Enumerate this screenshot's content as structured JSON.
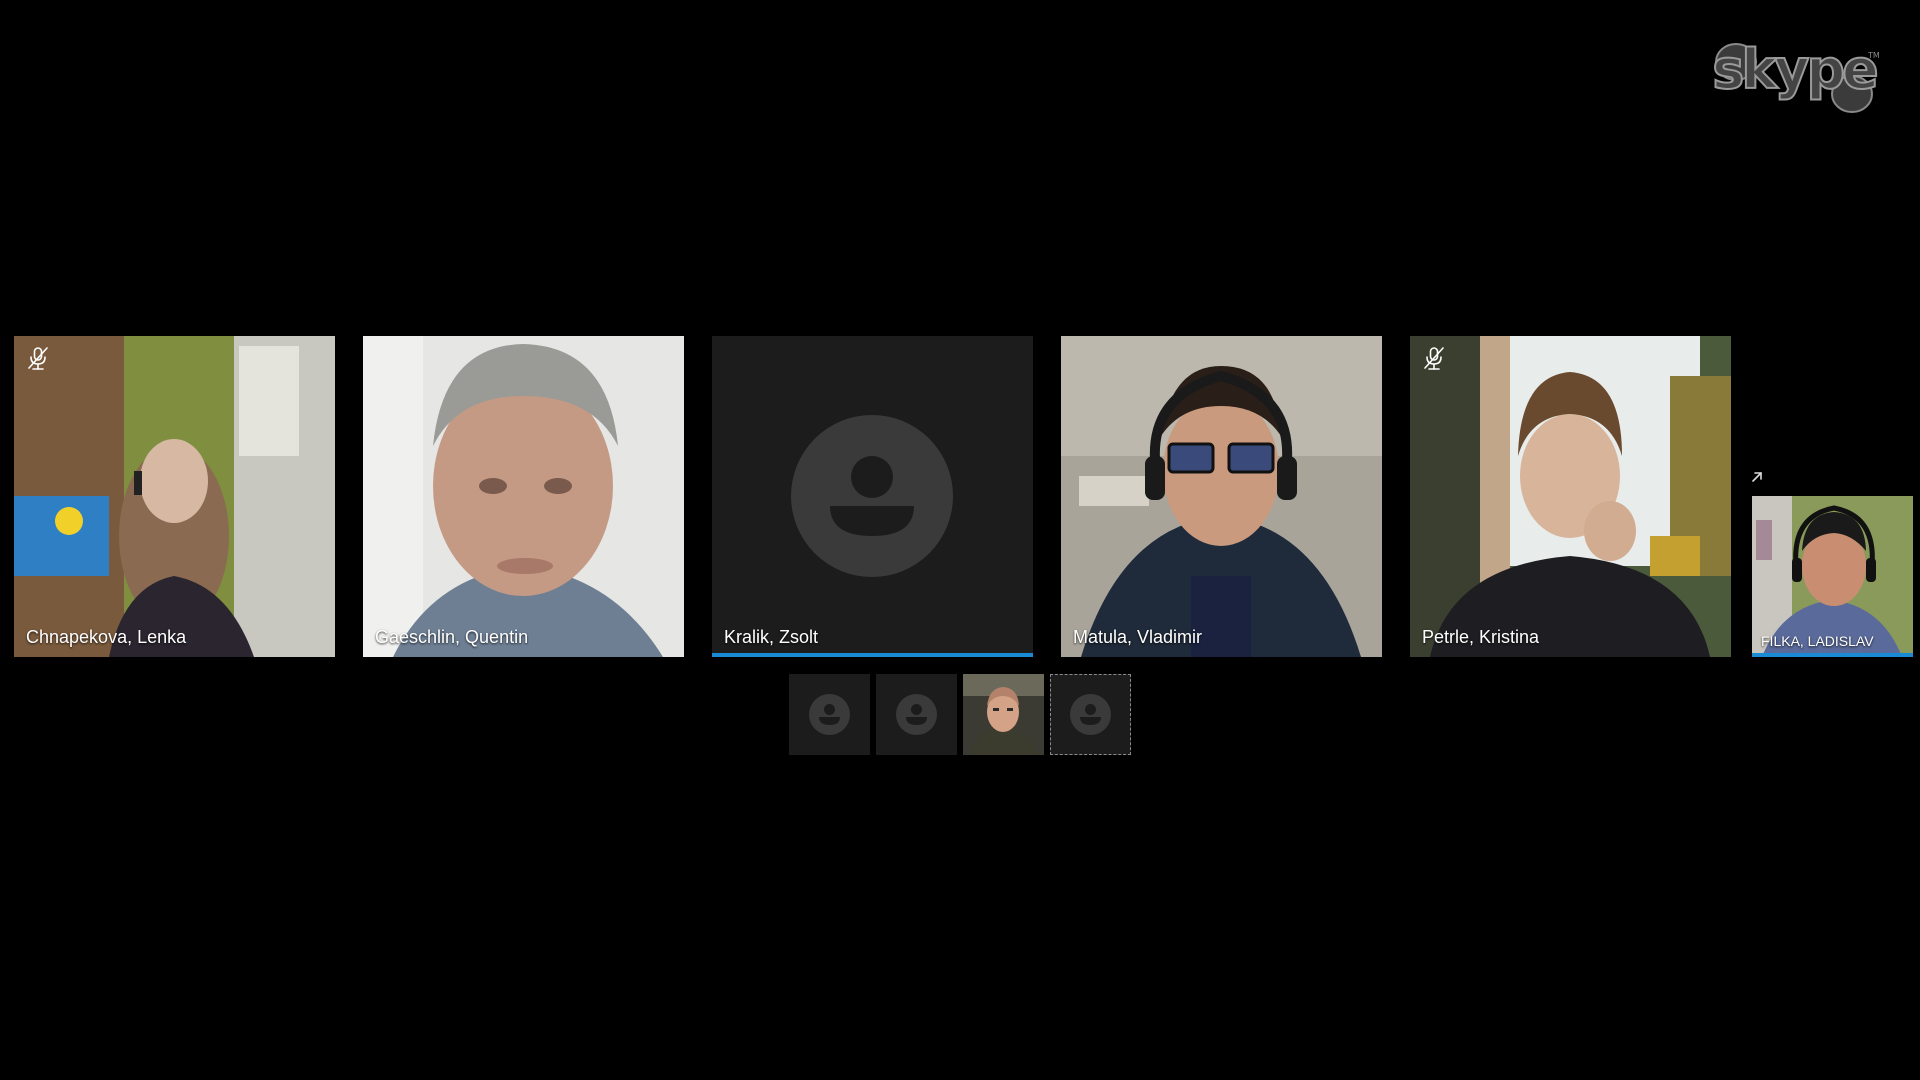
{
  "app": {
    "logo_icon": "skype-logo-icon",
    "accent_color": "#1a8ad4",
    "background_color": "#000000"
  },
  "participants": [
    {
      "name": "Chnapekova, Lenka",
      "muted": true,
      "speaking": false
    },
    {
      "name": "Gaeschlin, Quentin",
      "muted": false,
      "speaking": false
    },
    {
      "name": "Kralik, Zsolt",
      "muted": false,
      "speaking": true,
      "avatar": "default-avatar-icon"
    },
    {
      "name": "Matula, Vladimir",
      "muted": false,
      "speaking": false
    },
    {
      "name": "Petrle, Kristina",
      "muted": true,
      "speaking": false
    }
  ],
  "self_view": {
    "name": "FILKA, LADISLAV",
    "speaking": true,
    "popout_icon": "popout-arrow-icon"
  },
  "overflow_participants": [
    {
      "avatar": "default-avatar-icon",
      "focused": false
    },
    {
      "avatar": "default-avatar-icon",
      "focused": false
    },
    {
      "avatar": "photo",
      "focused": false
    },
    {
      "avatar": "default-avatar-icon",
      "focused": true
    }
  ]
}
